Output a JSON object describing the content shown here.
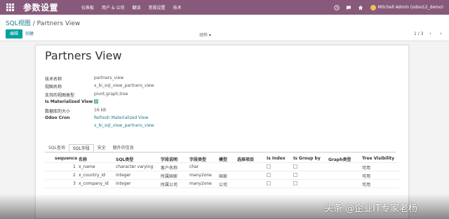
{
  "navbar": {
    "brand": "参数设置",
    "menu": [
      "仪表板",
      "用户 & 公司",
      "翻译",
      "常规设置",
      "技术"
    ],
    "user": "Mitchell Admin (odoo12_demo)"
  },
  "breadcrumb": {
    "parent": "SQL视图",
    "separator": "/",
    "current": "Partners View"
  },
  "buttons": {
    "edit": "编辑",
    "create": "创建",
    "action": "动作 ▾"
  },
  "pager": {
    "text": "1 / 3",
    "arrows": "‹ ›"
  },
  "form": {
    "title": "Partners View",
    "fields": [
      {
        "label": "技术名称",
        "value": "partners_view"
      },
      {
        "label": "视图名称",
        "value": "x_bi_sql_view_partners_view"
      },
      {
        "label": "支持的视图类型",
        "value": "pivot,graph,tree"
      },
      {
        "label": "Is Materialized View",
        "value": ""
      },
      {
        "label": "数据库的大小",
        "value": "16 kB"
      },
      {
        "label": "Odoo Cron",
        "value": "Refresh Materialized View"
      },
      {
        "label": "",
        "value": "x_bi_sql_view_partners_view"
      }
    ]
  },
  "tabs": [
    "SQL查询",
    "SQL字段",
    "安全",
    "额外的信息"
  ],
  "table": {
    "headers": [
      "sequence",
      "名称",
      "SQL类型",
      "字段说明",
      "字段类型",
      "模型",
      "选择项目",
      "Is Index",
      "Is Group by",
      "Graph类型",
      "Tree Visibility"
    ],
    "rows": [
      {
        "seq": "1",
        "name": "x_name",
        "sql_type": "character varying",
        "desc": "客户名称",
        "ftype": "char",
        "model": "",
        "tree": "可用"
      },
      {
        "seq": "2",
        "name": "x_country_id",
        "sql_type": "integer",
        "desc": "所属国家",
        "ftype": "many2one",
        "model": "国家",
        "tree": "可用"
      },
      {
        "seq": "3",
        "name": "x_company_id",
        "sql_type": "integer",
        "desc": "所属公司",
        "ftype": "many2one",
        "model": "公司",
        "tree": "可用"
      }
    ]
  },
  "watermark": "头条 @企业IT专家老杨",
  "colors": {
    "navbar": "#875a7b",
    "primary": "#00a09d",
    "link": "#1f7a8a"
  }
}
